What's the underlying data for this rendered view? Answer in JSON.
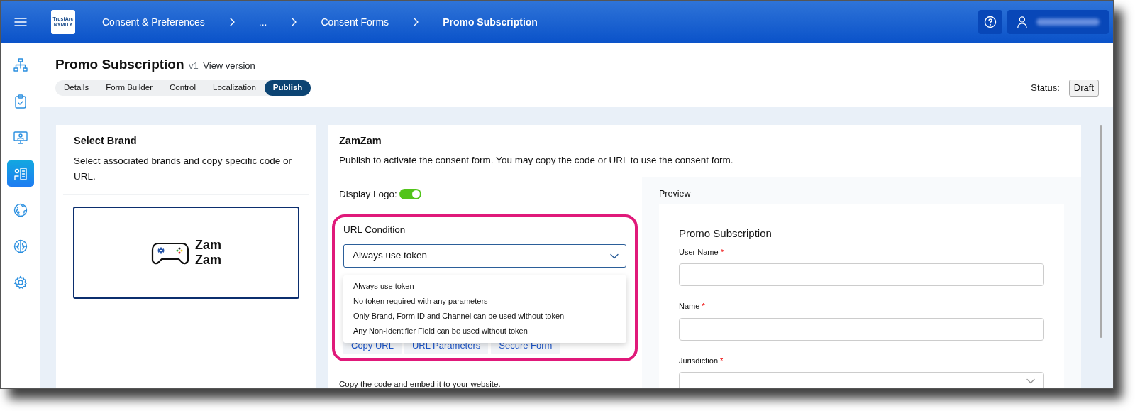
{
  "app_bar": {
    "logo": {
      "top": "TrustArc",
      "bottom": "NYMITY"
    },
    "breadcrumbs": [
      {
        "label": "Consent & Preferences",
        "current": false
      },
      {
        "label": "...",
        "current": false
      },
      {
        "label": "Consent Forms",
        "current": false
      },
      {
        "label": "Promo Subscription",
        "current": true
      }
    ]
  },
  "sidebar": {
    "items": [
      {
        "kind": "hierarchy",
        "selected": false
      },
      {
        "kind": "clipboard",
        "selected": false
      },
      {
        "kind": "monitor",
        "selected": false
      },
      {
        "kind": "person-list",
        "selected": true
      },
      {
        "kind": "globe",
        "selected": false
      },
      {
        "kind": "brain",
        "selected": false
      },
      {
        "kind": "gear",
        "selected": false
      }
    ]
  },
  "page": {
    "title": "Promo Subscription",
    "version": "v1",
    "version_link": "View version",
    "tabs": [
      {
        "label": "Details",
        "selected": false
      },
      {
        "label": "Form Builder",
        "selected": false
      },
      {
        "label": "Control",
        "selected": false
      },
      {
        "label": "Localization",
        "selected": false
      },
      {
        "label": "Publish",
        "selected": true
      }
    ],
    "status_label": "Status:",
    "status": "Draft"
  },
  "brand_panel": {
    "title": "Select Brand",
    "description": "Select associated brands and copy specific code or URL.",
    "brands": [
      {
        "name": "Zam Zam",
        "selected": true
      }
    ]
  },
  "publish_panel": {
    "title": "ZamZam",
    "description": "Publish to activate the consent form. You may copy the code or URL to use the consent form.",
    "display_logo": {
      "label": "Display Logo:",
      "on": true
    },
    "url_condition": {
      "label": "URL Condition",
      "value": "Always use token",
      "expanded": true,
      "highlighted": true,
      "options": [
        "Always use token",
        "No token required with any parameters",
        "Only Brand, Form ID and Channel can be used without token",
        "Any Non-Identifier Field can be used without token"
      ]
    },
    "link_tabs": [
      "Copy URL",
      "URL Parameters",
      "Secure Form"
    ],
    "embed_note": "Copy the code and embed it to your website."
  },
  "preview": {
    "title": "Preview",
    "form_title": "Promo Subscription",
    "fields": [
      {
        "label": "User Name",
        "required_mark": "*",
        "kind": "text"
      },
      {
        "label": "Name",
        "required_mark": "*",
        "kind": "text"
      },
      {
        "label": "Jurisdiction",
        "required_mark": "*",
        "kind": "select"
      }
    ]
  }
}
